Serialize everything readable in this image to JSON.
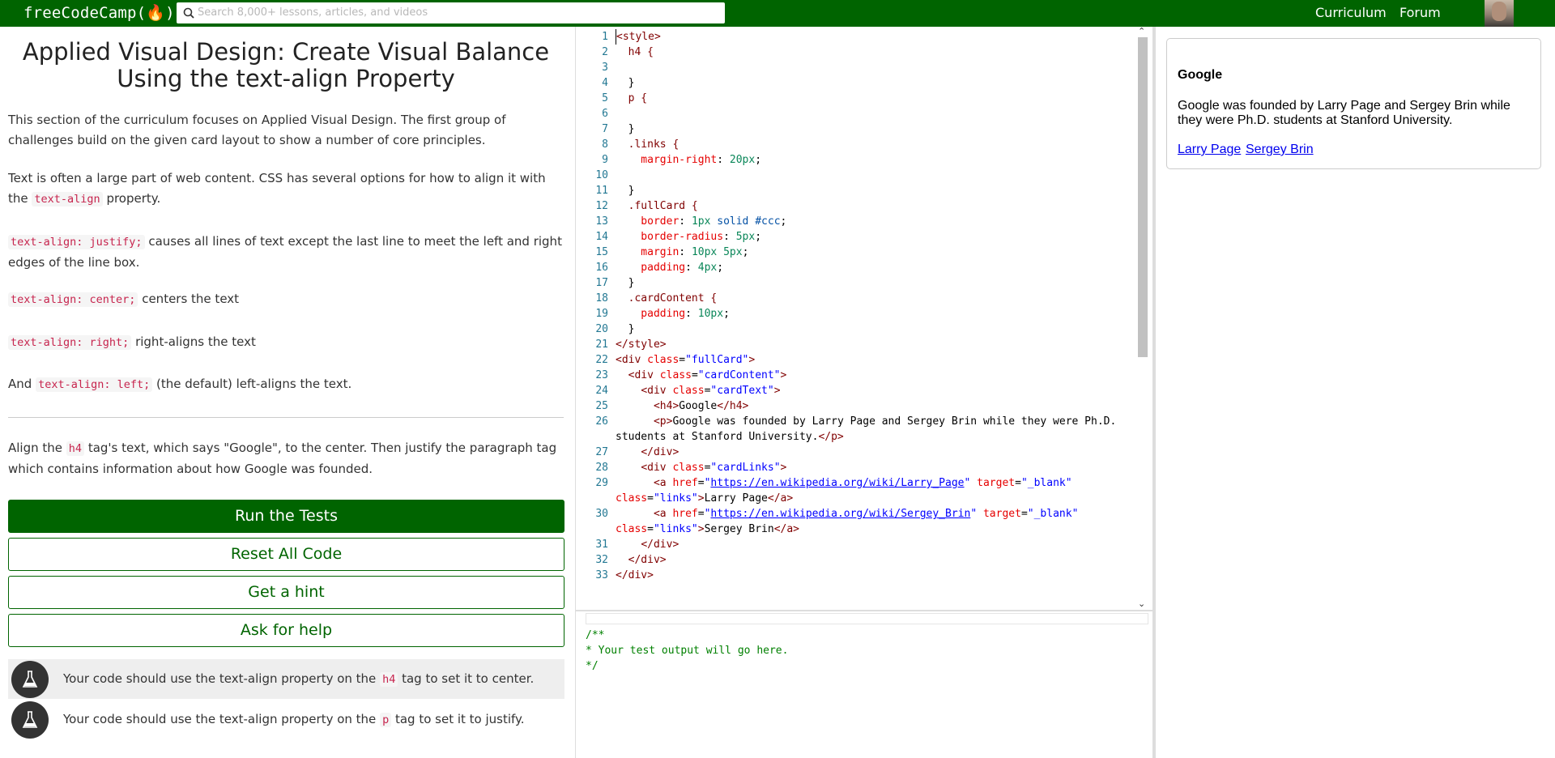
{
  "nav": {
    "logo": "freeCodeCamp(🔥)",
    "search_placeholder": "Search 8,000+ lessons, articles, and videos",
    "links": [
      "Curriculum",
      "Forum"
    ],
    "brand_color": "#006400"
  },
  "challenge": {
    "title": "Applied Visual Design: Create Visual Balance Using the text-align Property",
    "p1": "This section of the curriculum focuses on Applied Visual Design. The first group of challenges build on the given card layout to show a number of core principles.",
    "p2_a": "Text is often a large part of web content. CSS has several options for how to align it with the ",
    "p2_code": "text-align",
    "p2_b": " property.",
    "p3_code": "text-align: justify;",
    "p3_b": " causes all lines of text except the last line to meet the left and right edges of the line box.",
    "p4_code": "text-align: center;",
    "p4_b": " centers the text",
    "p5_code": "text-align: right;",
    "p5_b": " right-aligns the text",
    "p6_a": "And ",
    "p6_code": "text-align: left;",
    "p6_b": " (the default) left-aligns the text.",
    "p7_a": "Align the ",
    "p7_code": "h4",
    "p7_b": " tag's text, which says \"Google\", to the center. Then justify the paragraph tag which contains information about how Google was founded."
  },
  "buttons": {
    "run": "Run the Tests",
    "reset": "Reset All Code",
    "hint": "Get a hint",
    "help": "Ask for help"
  },
  "tests": [
    {
      "a": "Your code should use the text-align property on the ",
      "code": "h4",
      "b": " tag to set it to center."
    },
    {
      "a": "Your code should use the text-align property on the ",
      "code": "p",
      "b": " tag to set it to justify."
    }
  ],
  "editor": {
    "line_numbers": [
      "1",
      "2",
      "3",
      "4",
      "5",
      "6",
      "7",
      "8",
      "9",
      "10",
      "11",
      "12",
      "13",
      "14",
      "15",
      "16",
      "17",
      "18",
      "19",
      "20",
      "21",
      "22",
      "23",
      "24",
      "25",
      "26",
      "27",
      "28",
      "29",
      "30",
      "31",
      "32",
      "33"
    ],
    "l1": "<style>",
    "l2": "  h4 {",
    "l4": "  }",
    "l5": "  p {",
    "l7": "  }",
    "l8": "  .links {",
    "l9_p": "    margin-right",
    "l9_v": "20px",
    "l11": "  }",
    "l12": "  .fullCard {",
    "l13_p": "    border",
    "l13_v1": "1px",
    "l13_v2": "solid",
    "l13_v3": "#ccc",
    "l14_p": "    border-radius",
    "l14_v": "5px",
    "l15_p": "    margin",
    "l15_v": "10px 5px",
    "l16_p": "    padding",
    "l16_v": "4px",
    "l17": "  }",
    "l18": "  .cardContent {",
    "l19_p": "    padding",
    "l19_v": "10px",
    "l20": "  }",
    "l21": "</style>",
    "cls_fullCard": "\"fullCard\"",
    "cls_cardContent": "\"cardContent\"",
    "cls_cardText": "\"cardText\"",
    "l25_text": "Google",
    "l26_text": "Google was founded by Larry Page and Sergey Brin while they were Ph.D.",
    "l26_text2": "students at Stanford University.",
    "cls_cardLinks": "\"cardLinks\"",
    "url_larry": "https://en.wikipedia.org/wiki/Larry_Page",
    "url_sergey": "https://en.wikipedia.org/wiki/Sergey_Brin",
    "target_blank": "\"_blank\"",
    "cls_links": "\"links\"",
    "link_larry": "Larry Page",
    "link_sergey": "Sergey Brin"
  },
  "output": {
    "text": "/**\n* Your test output will go here.\n*/"
  },
  "preview": {
    "heading": "Google",
    "paragraph": "Google was founded by Larry Page and Sergey Brin while they were Ph.D. students at Stanford University.",
    "link1": "Larry Page",
    "link2": "Sergey Brin"
  }
}
